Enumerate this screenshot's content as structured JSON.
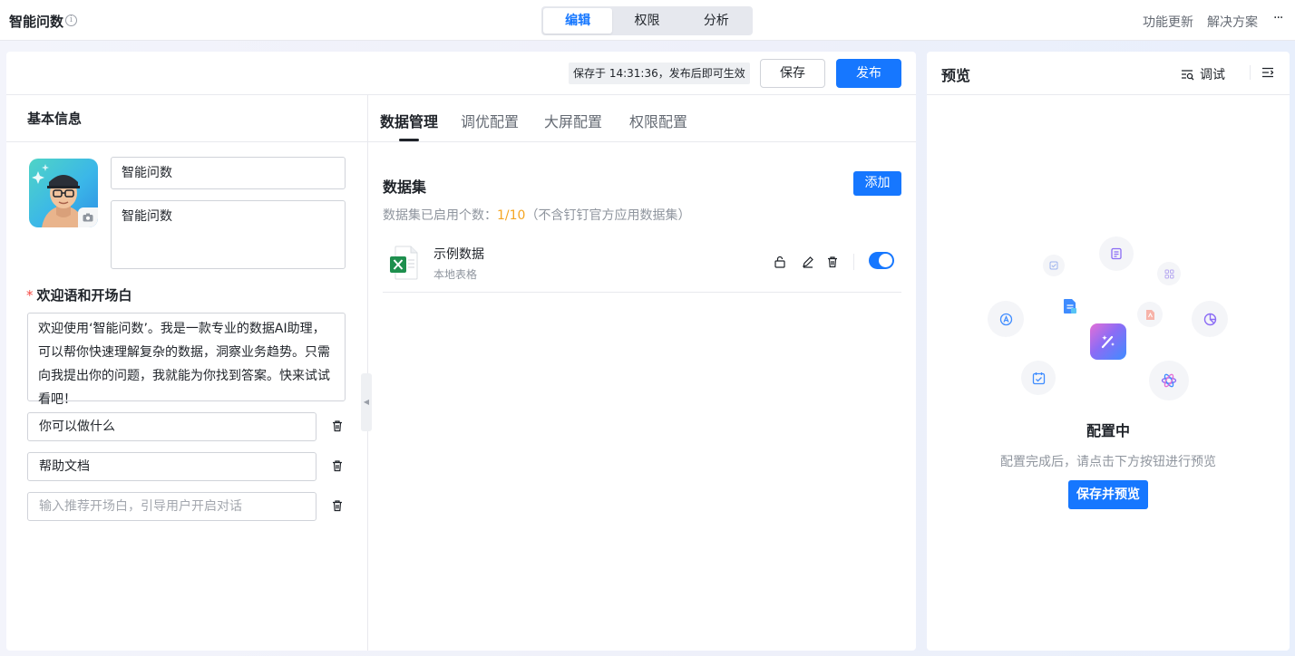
{
  "header": {
    "app_title": "智能问数",
    "info_glyph": "i",
    "mode_tabs": [
      {
        "label": "编辑",
        "active": true
      },
      {
        "label": "权限",
        "active": false
      },
      {
        "label": "分析",
        "active": false
      }
    ],
    "links": {
      "updates": "功能更新",
      "solutions": "解决方案"
    },
    "more": "···"
  },
  "toolbar": {
    "save_status": "保存于 14:31:36，发布后即可生效",
    "save_label": "保存",
    "publish_label": "发布"
  },
  "basic_info": {
    "title": "基本信息",
    "name_value": "智能问数",
    "description_value": "智能问数",
    "welcome_label": "欢迎语和开场白",
    "required_mark": "*",
    "welcome_text": "欢迎使用‘智能问数’。我是一款专业的数据AI助理，可以帮你快速理解复杂的数据，洞察业务趋势。只需向我提出你的问题，我就能为你找到答案。快来试试看吧！",
    "openers": [
      "你可以做什么",
      "帮助文档"
    ],
    "opener_placeholder": "输入推荐开场白，引导用户开启对话",
    "collapse_glyph": "◀"
  },
  "config_tabs": [
    {
      "label": "数据管理",
      "active": true
    },
    {
      "label": "调优配置",
      "active": false
    },
    {
      "label": "大屏配置",
      "active": false
    },
    {
      "label": "权限配置",
      "active": false
    }
  ],
  "dataset": {
    "title": "数据集",
    "add_label": "添加",
    "count_prefix": "数据集已启用个数：",
    "count_value": "1/10",
    "count_suffix": "（不含钉钉官方应用数据集）",
    "items": [
      {
        "name": "示例数据",
        "type": "本地表格",
        "enabled": true,
        "icon": "excel-file-icon"
      }
    ]
  },
  "preview": {
    "title": "预览",
    "debug_label": "调试",
    "state_title": "配置中",
    "hint": "配置完成后，请点击下方按钮进行预览",
    "button_label": "保存并预览"
  },
  "colors": {
    "primary": "#1677ff",
    "warning_count": "#f5a623",
    "required": "#f54a45"
  }
}
